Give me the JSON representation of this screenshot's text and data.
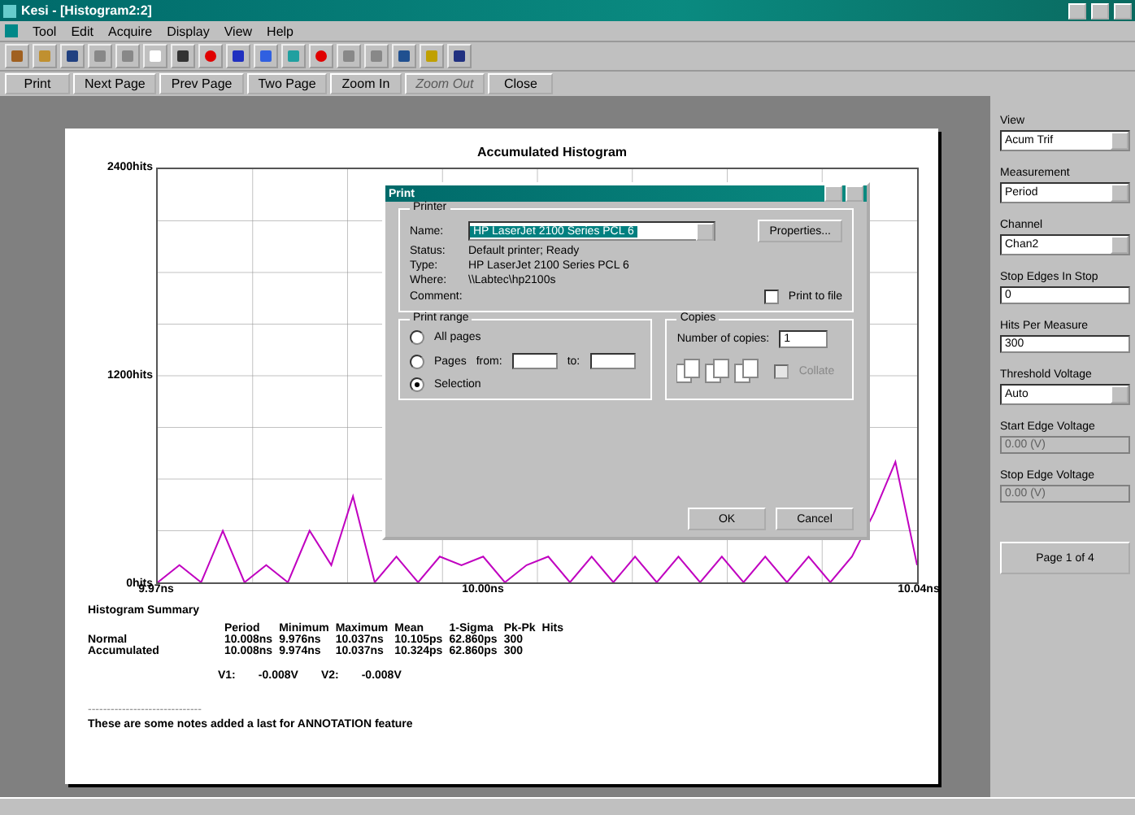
{
  "window": {
    "title": "Kesi - [Histogram2:2]"
  },
  "menu": [
    "Tool",
    "Edit",
    "Acquire",
    "Display",
    "View",
    "Help"
  ],
  "preview_buttons": [
    {
      "label": "Print",
      "disabled": false
    },
    {
      "label": "Next Page",
      "disabled": false
    },
    {
      "label": "Prev Page",
      "disabled": false
    },
    {
      "label": "Two Page",
      "disabled": false
    },
    {
      "label": "Zoom In",
      "disabled": false
    },
    {
      "label": "Zoom Out",
      "disabled": true
    },
    {
      "label": "Close",
      "disabled": false
    }
  ],
  "side_panel": [
    {
      "kind": "dropdown",
      "label": "View",
      "value": "Acum Trif"
    },
    {
      "kind": "dropdown",
      "label": "Measurement",
      "value": "Period"
    },
    {
      "kind": "dropdown",
      "label": "Channel",
      "value": "Chan2"
    },
    {
      "kind": "field",
      "label": "Stop Edges In Stop",
      "value": "0",
      "disabled": false
    },
    {
      "kind": "field",
      "label": "Hits Per Measure",
      "value": "300",
      "disabled": false
    },
    {
      "kind": "dropdown",
      "label": "Threshold Voltage",
      "value": "Auto"
    },
    {
      "kind": "field",
      "label": "Start Edge Voltage",
      "value": "0.00 (V)",
      "disabled": true
    },
    {
      "kind": "field",
      "label": "Stop Edge Voltage",
      "value": "0.00 (V)",
      "disabled": true
    }
  ],
  "page_button": "Page 1 of 4",
  "report": {
    "chart": {
      "chart_data": {
        "type": "line",
        "title": "Accumulated Histogram",
        "xlim": [
          9.97,
          10.04
        ],
        "ylim": [
          0,
          2400
        ],
        "x": [
          9.97,
          9.972,
          9.974,
          9.976,
          9.978,
          9.98,
          9.982,
          9.984,
          9.986,
          9.988,
          9.99,
          9.992,
          9.994,
          9.996,
          9.998,
          10.0,
          10.002,
          10.004,
          10.006,
          10.008,
          10.01,
          10.012,
          10.014,
          10.016,
          10.018,
          10.02,
          10.022,
          10.024,
          10.026,
          10.028,
          10.03,
          10.032,
          10.034,
          10.036,
          10.038,
          10.04
        ],
        "xticks": [
          {
            "value": 9.97,
            "label": "9.97ns"
          },
          {
            "value": 10.0,
            "label": "10.00ns"
          },
          {
            "value": 10.04,
            "label": "10.04ns"
          }
        ],
        "yticks": [
          {
            "value": 0,
            "label": "0hits"
          },
          {
            "value": 1200,
            "label": "1200hits"
          },
          {
            "value": 2400,
            "label": "2400hits"
          }
        ],
        "series": [
          {
            "color": "#c000c0",
            "values": [
              0,
              100,
              0,
              300,
              0,
              100,
              0,
              300,
              100,
              500,
              0,
              150,
              0,
              150,
              100,
              150,
              0,
              100,
              150,
              0,
              150,
              0,
              150,
              0,
              150,
              0,
              150,
              0,
              150,
              0,
              150,
              0,
              150,
              400,
              700,
              100
            ]
          }
        ]
      }
    },
    "summary": {
      "title": "Histogram Summary",
      "header": [
        "Period",
        "Minimum",
        "Maximum",
        "Mean",
        "1-Sigma",
        "Pk-Pk",
        "Hits"
      ],
      "rows": [
        {
          "label": "Normal",
          "values": [
            "10.008ns",
            "9.976ns",
            "10.037ns",
            "10.105ps",
            "62.860ps",
            "300"
          ]
        },
        {
          "label": "Accumulated",
          "values": [
            "10.008ns",
            "9.974ns",
            "10.037ns",
            "10.324ps",
            "62.860ps",
            "300"
          ]
        }
      ]
    },
    "voltages": [
      "V1:",
      "-0.008V",
      "V2:",
      "-0.008V"
    ],
    "separator": "------------------------------",
    "notes": "These are some notes added a last for ANNOTATION feature"
  },
  "print_dialog": {
    "title": "Print",
    "printer_group": "Printer",
    "name_label": "Name:",
    "name_value": "HP LaserJet 2100 Series PCL 6",
    "properties": "Properties...",
    "info": [
      {
        "label": "Status:",
        "value": "Default printer; Ready"
      },
      {
        "label": "Type:",
        "value": "HP LaserJet 2100 Series PCL 6"
      },
      {
        "label": "Where:",
        "value": "\\\\Labtec\\hp2100s"
      },
      {
        "label": "Comment:"
      }
    ],
    "print_to_file": {
      "label": "Print to file",
      "checked": false
    },
    "range_group": "Print range",
    "ranges": [
      {
        "label": "All pages",
        "selected": false
      },
      {
        "label": "Pages",
        "selected": false
      },
      {
        "label": "Selection",
        "selected": true
      }
    ],
    "from_label": "from:",
    "to_label": "to:",
    "copies_group": "Copies",
    "copies_label": "Number of copies:",
    "copies": "1",
    "collate": {
      "label": "Collate",
      "checked": false,
      "disabled": true
    },
    "buttons": [
      "OK",
      "Cancel"
    ]
  }
}
